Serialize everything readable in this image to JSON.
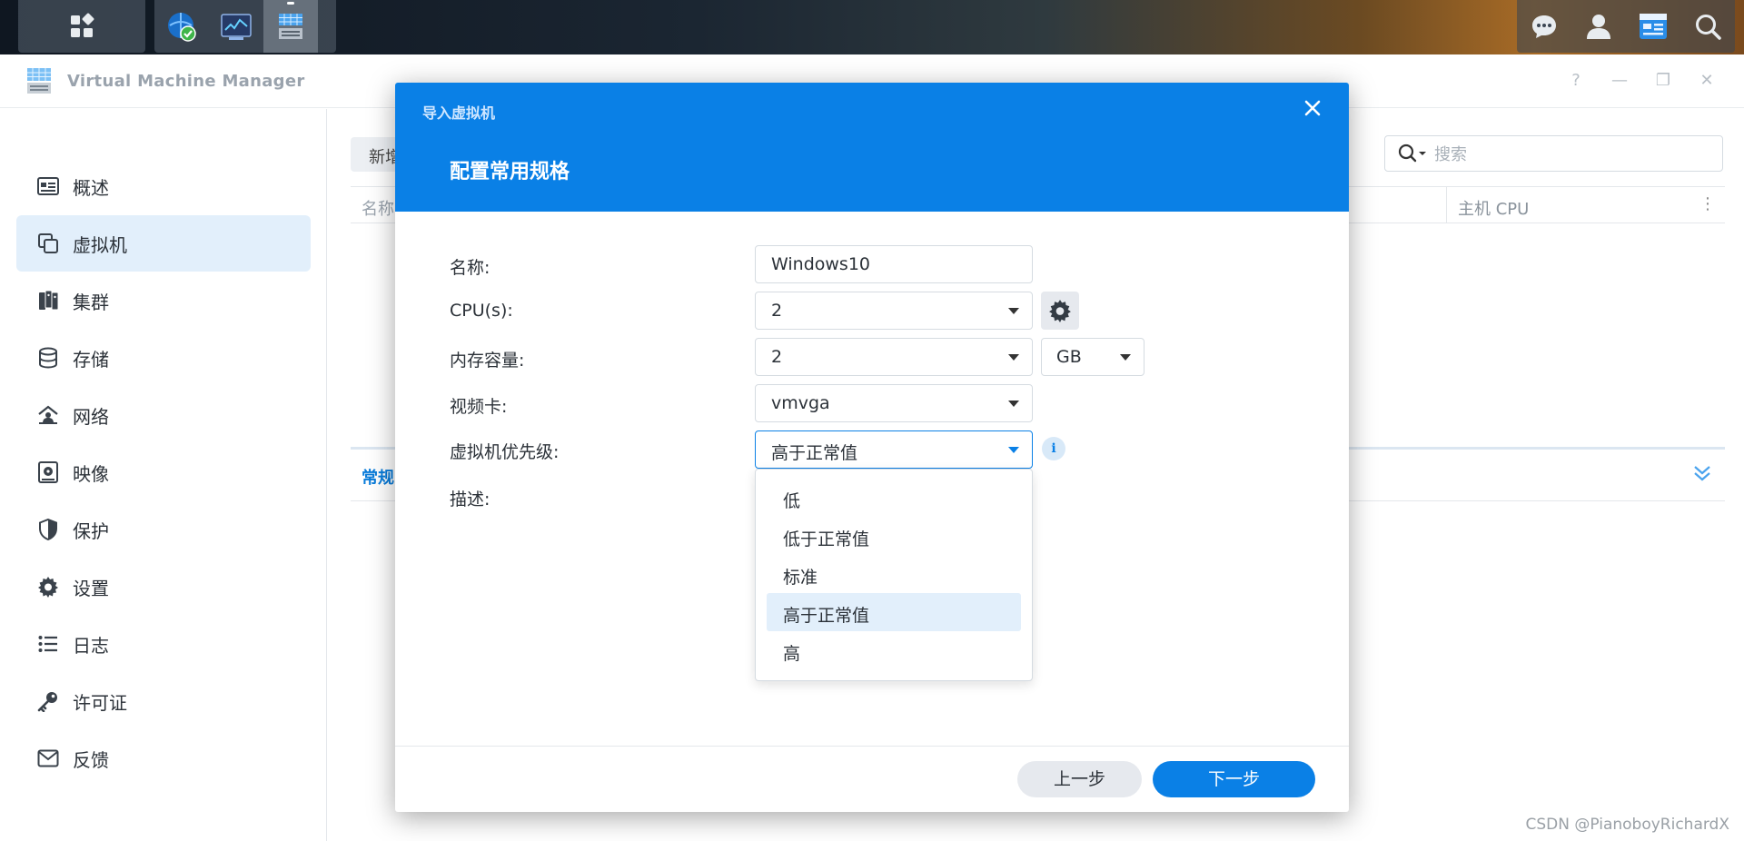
{
  "app": {
    "title": "Virtual Machine Manager",
    "window_controls": [
      "?",
      "—",
      "❐",
      "✕"
    ]
  },
  "sidebar": {
    "items": [
      {
        "label": "概述",
        "icon": "overview-icon"
      },
      {
        "label": "虚拟机",
        "icon": "virtual-machine-icon",
        "active": true
      },
      {
        "label": "集群",
        "icon": "cluster-icon"
      },
      {
        "label": "存储",
        "icon": "storage-icon"
      },
      {
        "label": "网络",
        "icon": "network-icon"
      },
      {
        "label": "映像",
        "icon": "image-icon"
      },
      {
        "label": "保护",
        "icon": "shield-icon"
      },
      {
        "label": "设置",
        "icon": "gear-icon"
      },
      {
        "label": "日志",
        "icon": "log-list-icon"
      },
      {
        "label": "许可证",
        "icon": "key-icon"
      },
      {
        "label": "反馈",
        "icon": "mail-icon"
      }
    ]
  },
  "main": {
    "toolbar_button": "新增",
    "search_placeholder": "搜索",
    "table_header_name": "名称",
    "table_header_cpu": "主机 CPU",
    "tab_general": "常规"
  },
  "dialog": {
    "kicker": "导入虚拟机",
    "title": "配置常用规格",
    "labels": {
      "name": "名称:",
      "cpus": "CPU(s):",
      "memory": "内存容量:",
      "video": "视频卡:",
      "priority": "虚拟机优先级:",
      "description": "描述:"
    },
    "values": {
      "name": "Windows10",
      "cpus": "2",
      "memory": "2",
      "memory_unit": "GB",
      "video": "vmvga",
      "priority": "高于正常值"
    },
    "priority_options": [
      "低",
      "低于正常值",
      "标准",
      "高于正常值",
      "高"
    ],
    "priority_selected_index": 3,
    "buttons": {
      "prev": "上一步",
      "next": "下一步"
    }
  },
  "watermark": "CSDN @PianoboyRichardX",
  "colors": {
    "accent": "#0a80e6",
    "selected_bg": "#e2effb"
  }
}
